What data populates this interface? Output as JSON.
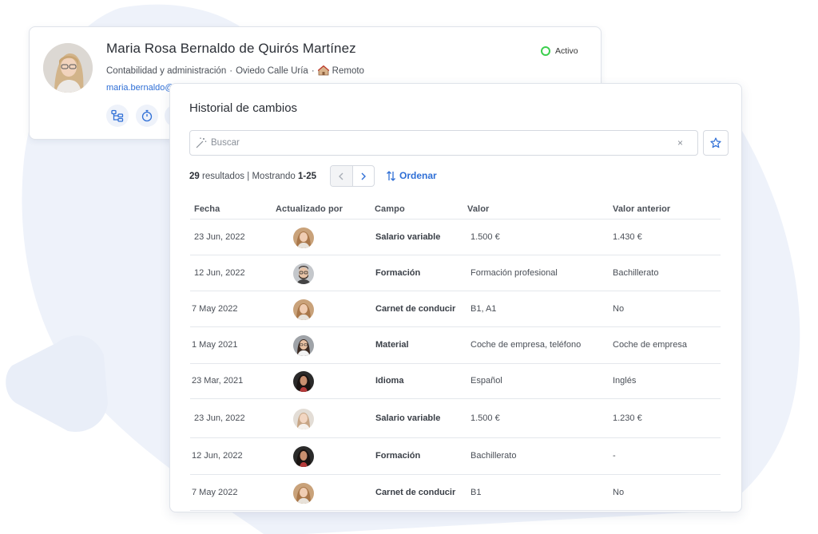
{
  "profile": {
    "name": "Maria Rosa Bernaldo de Quirós Martínez",
    "department": "Contabilidad y administración",
    "separator": "·",
    "location": "Oviedo Calle Uría",
    "work_mode": "Remoto",
    "email": "maria.bernaldo@",
    "status": "Activo",
    "colors": {
      "status": "#3ccf4e",
      "accent": "#2f6fd6"
    }
  },
  "history": {
    "title": "Historial de cambios",
    "search": {
      "placeholder": "Buscar",
      "clear": "×"
    },
    "results": {
      "count": "29",
      "count_label": "resultados",
      "sep": "|",
      "showing_label": "Mostrando",
      "range": "1-25"
    },
    "sort_label": "Ordenar",
    "columns": {
      "date": "Fecha",
      "updated_by": "Actualizado por",
      "field": "Campo",
      "value": "Valor",
      "previous": "Valor anterior"
    },
    "rows": [
      {
        "date": "23 Jun, 2022",
        "avatar": "woman-blonde",
        "field": "Salario variable",
        "value": "1.500 €",
        "previous": "1.430 €"
      },
      {
        "date": "12 Jun, 2022",
        "avatar": "man-beard-glasses",
        "field": "Formación",
        "value": "Formación profesional",
        "previous": "Bachillerato"
      },
      {
        "date": "7 May 2022",
        "avatar": "woman-blonde",
        "field": "Carnet de conducir",
        "value": "B1, A1",
        "previous": "No"
      },
      {
        "date": "1 May 2021",
        "avatar": "woman-glasses",
        "field": "Material",
        "value": "Coche de empresa, teléfono",
        "previous": "Coche de empresa"
      },
      {
        "date": "23 Mar, 2021",
        "avatar": "woman-dark-hair",
        "field": "Idioma",
        "value": "Español",
        "previous": "Inglés"
      },
      {
        "date": "23 Jun, 2022",
        "avatar": "woman-light",
        "field": "Salario variable",
        "value": "1.500 €",
        "previous": "1.230 €"
      },
      {
        "date": "12 Jun, 2022",
        "avatar": "woman-dark-hair",
        "field": "Formación",
        "value": "Bachillerato",
        "previous": "-"
      },
      {
        "date": "7 May 2022",
        "avatar": "woman-blonde",
        "field": "Carnet de conducir",
        "value": "B1",
        "previous": "No"
      }
    ]
  }
}
